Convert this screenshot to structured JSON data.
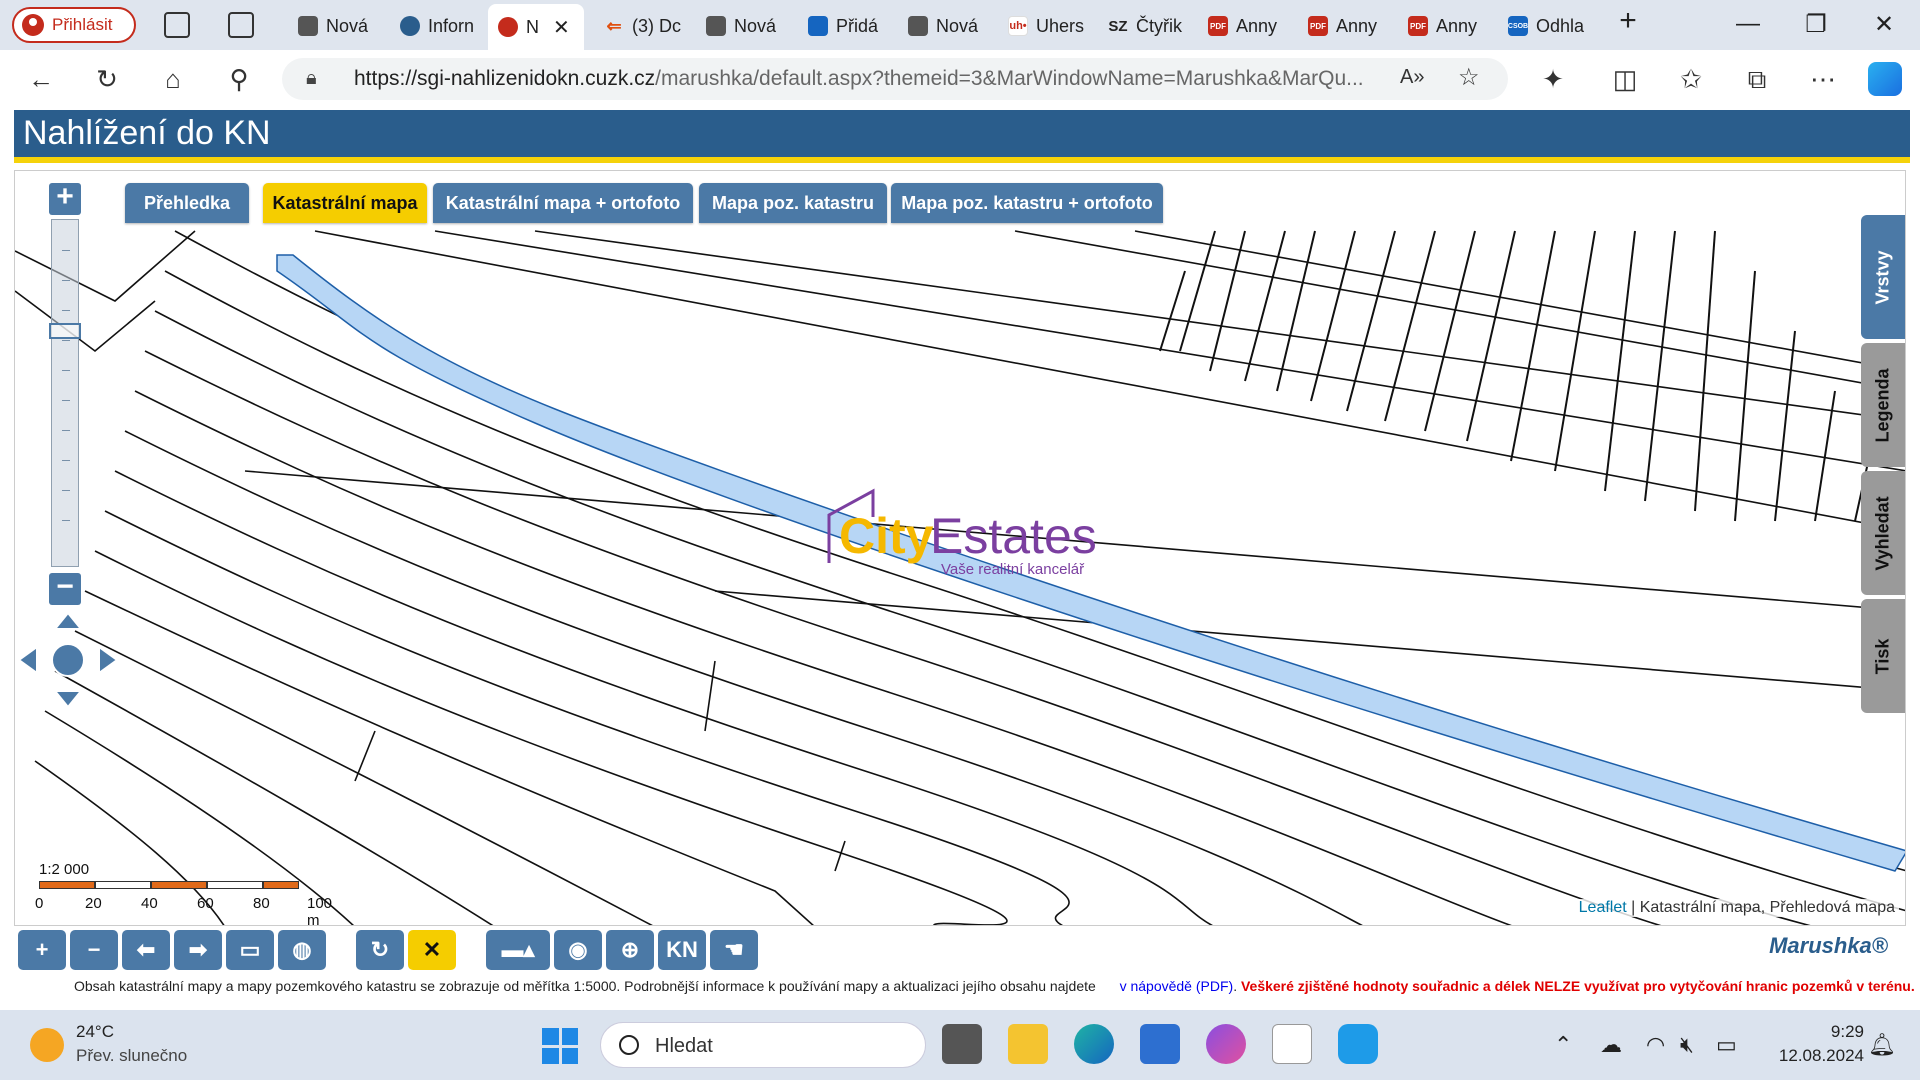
{
  "browser": {
    "profile_label": "Přihlásit",
    "tabs": [
      {
        "label": "Nová",
        "icon": "new-tab-icon"
      },
      {
        "label": "Inforn",
        "icon": "globe-icon"
      },
      {
        "label": "N",
        "icon": "cuzk-icon",
        "active": true
      },
      {
        "label": "(3) Dc",
        "icon": "sreality-icon"
      },
      {
        "label": "Nová",
        "icon": "new-tab-icon"
      },
      {
        "label": "Přidá",
        "icon": "image-icon"
      },
      {
        "label": "Nová",
        "icon": "new-tab-icon"
      },
      {
        "label": "Uhers",
        "icon": "uh-icon"
      },
      {
        "label": "Čtyřik",
        "icon": "sz-icon"
      },
      {
        "label": "Anny",
        "icon": "pdf-icon"
      },
      {
        "label": "Anny",
        "icon": "pdf-icon"
      },
      {
        "label": "Anny",
        "icon": "pdf-icon"
      },
      {
        "label": "Odhla",
        "icon": "csob-icon"
      }
    ],
    "tab_fav_text": {
      "uh": "uh•",
      "sz": "SZ",
      "pdf": "PDF",
      "csob": "CSOB"
    },
    "url_host": "https://sgi-nahlizenidokn.cuzk.cz",
    "url_rest": "/marushka/default.aspx?themeid=3&MarWindowName=Marushka&MarQu..."
  },
  "app": {
    "title": "Nahlížení do KN",
    "map_tabs": [
      {
        "label": "Přehledka",
        "selected": false
      },
      {
        "label": "Katastrální mapa",
        "selected": true
      },
      {
        "label": "Katastrální mapa + ortofoto",
        "selected": false
      },
      {
        "label": "Mapa poz. katastru",
        "selected": false
      },
      {
        "label": "Mapa poz. katastru + ortofoto",
        "selected": false
      }
    ],
    "side_tabs": [
      "Vrstvy",
      "Legenda",
      "Vyhledat",
      "Tisk"
    ],
    "zoom_in": "+",
    "zoom_out": "−",
    "watermark": {
      "city": "City",
      "estates": "Estates",
      "sub": "Vaše realitní kancelář"
    },
    "scale": {
      "ratio": "1:2 000",
      "labels": [
        "0",
        "20",
        "40",
        "60",
        "80",
        "100 m"
      ]
    },
    "attribution": {
      "leaflet": "Leaflet",
      "rest": " | Katastrální mapa, Přehledová mapa"
    },
    "toolbar_kn": "KN",
    "brand": "Marushka®",
    "footer": {
      "text": "Obsah katastrální mapy a mapy pozemkového katastru se zobrazuje od měřítka 1:5000. Podrobnější informace k používání mapy a aktualizaci jejího obsahu najdete",
      "link": "v nápovědě (PDF)",
      "warning": "Veškeré zjištěné hodnoty souřadnic a délek NELZE využívat pro vytyčování hranic pozemků v terénu."
    }
  },
  "taskbar": {
    "temp": "24°C",
    "weather": "Přev. slunečno",
    "search": "Hledat",
    "time": "9:29",
    "date": "12.08.2024"
  },
  "colors": {
    "header": "#2a5d8c",
    "accent": "#f5cd00",
    "highlight_parcel": "#b7d6f5"
  }
}
